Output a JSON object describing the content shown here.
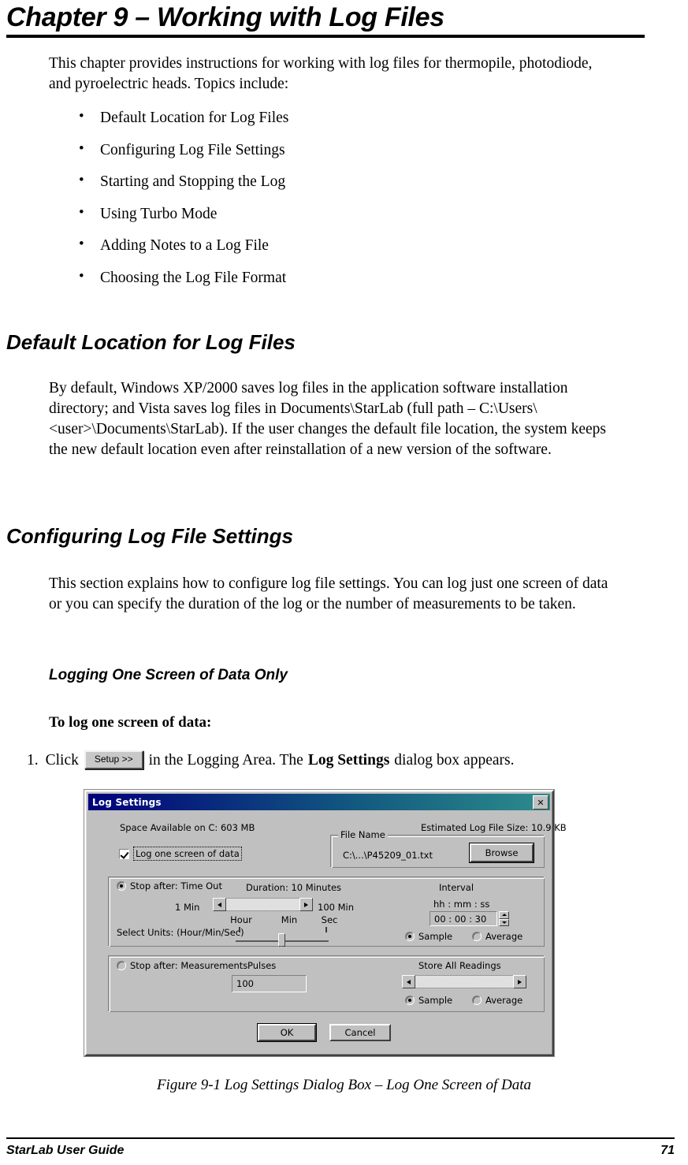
{
  "chapter": {
    "title": "Chapter 9 – Working with Log Files",
    "intro": "This chapter provides instructions for working with log files for thermopile, photodiode, and pyroelectric heads. Topics include:",
    "topics": [
      "Default Location for Log Files",
      "Configuring Log File Settings",
      "Starting and Stopping the Log",
      "Using Turbo Mode",
      "Adding Notes to a Log File",
      "Choosing the Log File Format"
    ]
  },
  "sections": {
    "default_location": {
      "heading": "Default Location for Log Files",
      "body": "By default, Windows XP/2000 saves log files in the application software installation directory; and Vista saves log files in Documents\\StarLab (full path – C:\\Users\\<user>\\Documents\\StarLab). If the user changes the default file location, the system keeps the new default location even after reinstallation of a new version of the software."
    },
    "configuring": {
      "heading": "Configuring Log File Settings",
      "body": "This section explains how to configure log file settings. You can log just one screen of data or you can specify the duration of the log or the number of measurements to be taken.",
      "subheading": "Logging One Screen of Data Only",
      "lead_in": "To log one screen of data:",
      "step": {
        "number": "1.",
        "text_before": "Click",
        "button_label": "Setup >>",
        "text_middle": "in the Logging Area. The",
        "bold_term": "Log Settings",
        "text_after": "dialog box appears."
      }
    }
  },
  "dialog": {
    "title": "Log Settings",
    "close_label": "✕",
    "space_available": "Space Available on C: 603 MB",
    "estimated_size": "Estimated Log File Size: 10.9 KB",
    "log_one_screen": {
      "label": "Log one screen of data",
      "checked": true
    },
    "file_name": {
      "caption": "File Name",
      "value": "C:\\...\\P45209_01.txt",
      "browse_label": "Browse"
    },
    "time_out_group": {
      "radio_label": "Stop after: Time Out",
      "duration_label": "Duration: 10 Minutes",
      "slider_min_label": "1 Min",
      "slider_max_label": "100 Min",
      "units_label": "Select Units: (Hour/Min/Sec)",
      "unit_ticks": [
        "Hour",
        "Min",
        "Sec"
      ],
      "selected_unit": "Min",
      "interval_caption": "Interval",
      "interval_format": "hh : mm : ss",
      "interval_value": "00 : 00 : 30",
      "sample_label": "Sample",
      "average_label": "Average",
      "selected_mode": "Sample"
    },
    "measurements_group": {
      "radio_label": "Stop after: Measurements",
      "pulses_label": "Pulses",
      "pulses_value": "100",
      "store_all_label": "Store All Readings",
      "sample_label": "Sample",
      "average_label": "Average",
      "selected_mode": "Sample"
    },
    "ok_label": "OK",
    "cancel_label": "Cancel"
  },
  "figure_caption": "Figure 9-1 Log Settings Dialog Box – Log One Screen of Data",
  "footer": {
    "left": "StarLab User Guide",
    "page_number": "71"
  },
  "colors": {
    "titlebar_start": "#00007b",
    "titlebar_end": "#2c8c8c",
    "dialog_face": "#c0c0c0"
  }
}
